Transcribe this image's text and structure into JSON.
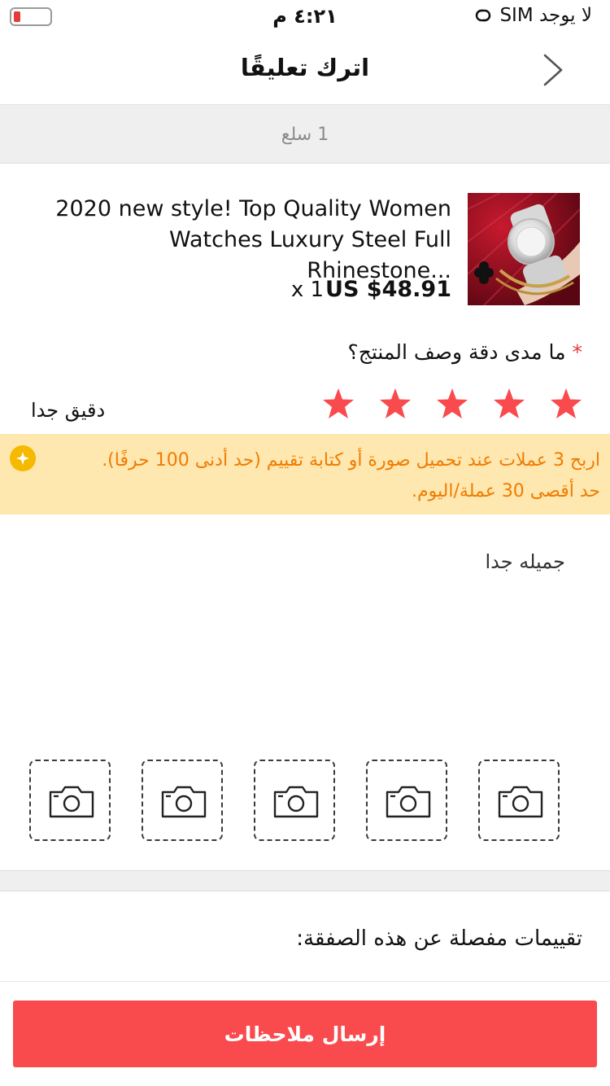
{
  "status_bar": {
    "carrier": "لا يوجد SIM",
    "time": "٤:٢١ م",
    "battery_color": "#e53b3b"
  },
  "header": {
    "title": "اترك تعليقًا",
    "back_icon": "chevron-right-icon"
  },
  "order": {
    "item_count": "1 سلع"
  },
  "product": {
    "title": "2020 new style! Top Quality Women Watches Luxury Steel Full Rhinestone...",
    "price": "US $48.91",
    "quantity": "x 1",
    "image_icon": "product-watch-image"
  },
  "rating": {
    "question": "ما مدى دقة وصف المنتج؟",
    "required_marker": "*",
    "stars_value": 5,
    "stars_max": 5,
    "star_color": "#f94a4e",
    "label": "دقيق جدا"
  },
  "banner": {
    "icon": "coin-icon",
    "text_line1": "اربح 3 عملات عند تحميل صورة أو كتابة تقييم (حد أدنى 100 حرفًا).",
    "text_line2": "حد أقصى 30 عملة/اليوم.",
    "bg_color": "#ffe7b0",
    "text_color": "#f07c00"
  },
  "review": {
    "text": "جميله جدا"
  },
  "photos": {
    "slot_count": 5,
    "icon": "camera-icon"
  },
  "detailed_ratings": {
    "heading": "تقييمات مفصلة عن هذه الصفقة:"
  },
  "submit": {
    "label": "إرسال ملاحظات",
    "color": "#f94a4e"
  }
}
